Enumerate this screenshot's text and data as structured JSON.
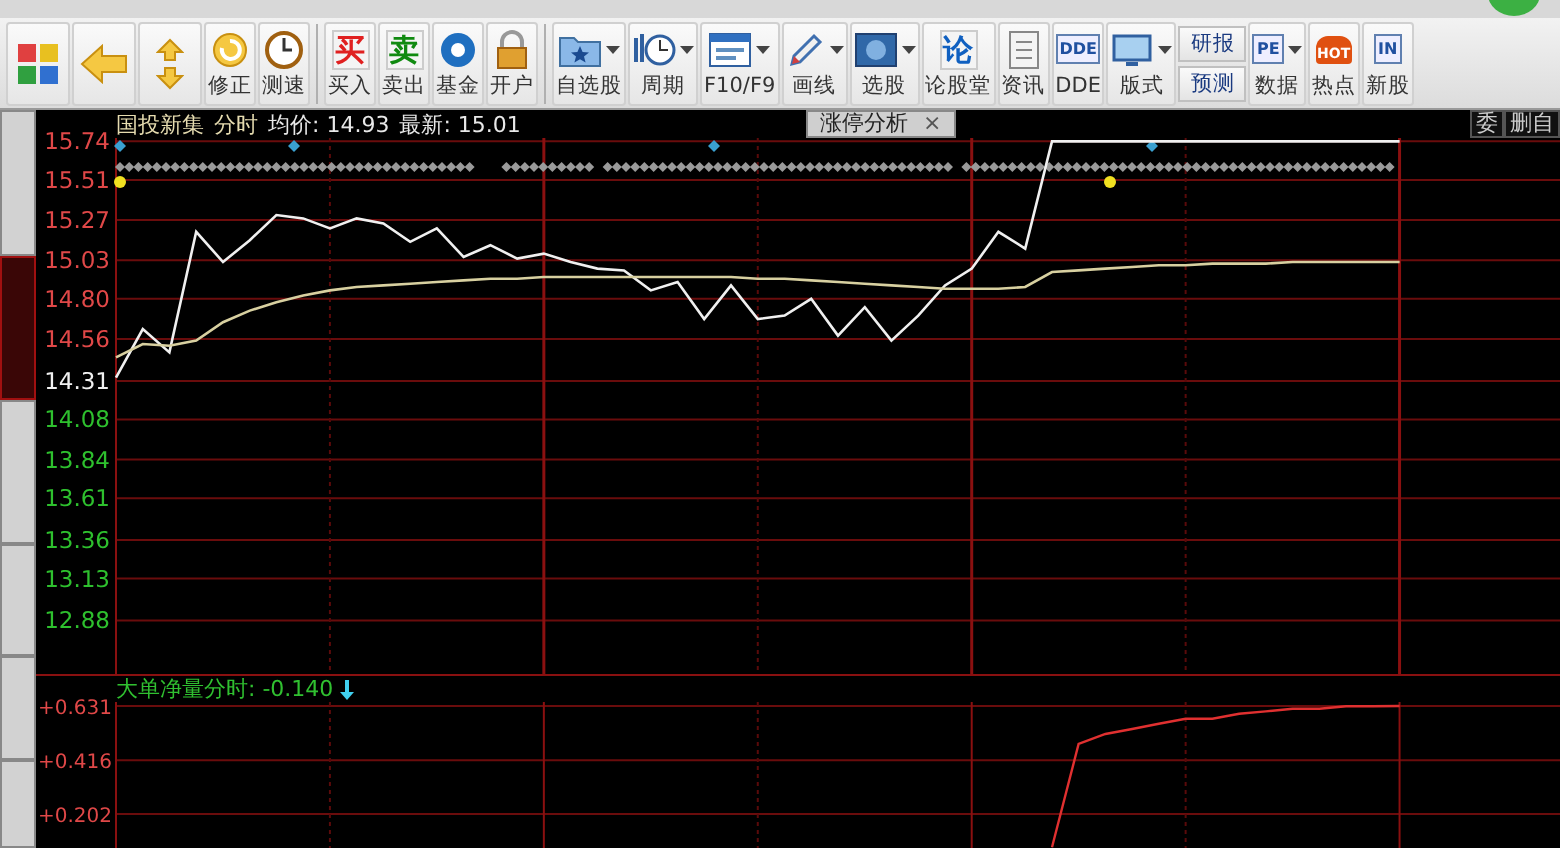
{
  "toolbar": [
    {
      "kind": "tiles"
    },
    {
      "kind": "back"
    },
    {
      "kind": "updown"
    },
    {
      "kind": "refresh",
      "label": "修正"
    },
    {
      "kind": "clock",
      "label": "测速"
    },
    {
      "kind": "sep"
    },
    {
      "kind": "glyph",
      "glyph": "买",
      "color": "#e02020",
      "label": "买入"
    },
    {
      "kind": "glyph",
      "glyph": "卖",
      "color": "#108a10",
      "label": "卖出"
    },
    {
      "kind": "disc",
      "label": "基金"
    },
    {
      "kind": "lock",
      "label": "开户"
    },
    {
      "kind": "sep"
    },
    {
      "kind": "folder",
      "label": "自选股",
      "dropdown": true
    },
    {
      "kind": "period",
      "label": "周期",
      "dropdown": true
    },
    {
      "kind": "window",
      "label": "F10/F9",
      "dropdown": true
    },
    {
      "kind": "pencil",
      "label": "画线",
      "dropdown": true
    },
    {
      "kind": "monitor",
      "label": "选股",
      "dropdown": true
    },
    {
      "kind": "glyph",
      "glyph": "论",
      "color": "#1060c0",
      "label": "论股堂"
    },
    {
      "kind": "doc",
      "label": "资讯"
    },
    {
      "kind": "tag",
      "tag": "DDE",
      "label": "DDE"
    },
    {
      "kind": "screen",
      "label": "版式",
      "dropdown": true
    },
    {
      "kind": "pair",
      "labels": [
        "研报",
        "预测"
      ]
    },
    {
      "kind": "tag",
      "tag": "PE",
      "label": "数据",
      "dropdown": true
    },
    {
      "kind": "fire",
      "tag": "HOT",
      "label": "热点"
    },
    {
      "kind": "tag",
      "tag": "IN",
      "label": "新股"
    }
  ],
  "sidebar": {
    "tabs": [
      {
        "selected": false
      },
      {
        "selected": true
      },
      {
        "selected": false
      },
      {
        "selected": false
      },
      {
        "selected": false
      },
      {
        "selected": false
      }
    ]
  },
  "header": {
    "stock": "国投新集",
    "mode": "分时",
    "average": "均价: 14.93",
    "latest": "最新: 15.01",
    "tab": {
      "label": "涨停分析",
      "close": "×"
    },
    "right_items": [
      "委",
      "删自"
    ]
  },
  "chart_data": {
    "type": "line",
    "grid": true,
    "ylim": [
      12.56,
      15.76
    ],
    "yticks": [
      {
        "value": 15.74,
        "label": "15.74"
      },
      {
        "value": 15.51,
        "label": "15.51"
      },
      {
        "value": 15.27,
        "label": "15.27"
      },
      {
        "value": 15.03,
        "label": "15.03"
      },
      {
        "value": 14.8,
        "label": "14.80"
      },
      {
        "value": 14.56,
        "label": "14.56"
      },
      {
        "value": 14.31,
        "label": "14.31"
      },
      {
        "value": 14.08,
        "label": "14.08"
      },
      {
        "value": 13.84,
        "label": "13.84"
      },
      {
        "value": 13.61,
        "label": "13.61"
      },
      {
        "value": 13.36,
        "label": "13.36"
      },
      {
        "value": 13.13,
        "label": "13.13"
      },
      {
        "value": 12.88,
        "label": "12.88"
      }
    ],
    "series": [
      {
        "color": "#f0f0f0",
        "values": [
          14.33,
          14.62,
          14.48,
          15.2,
          15.02,
          15.15,
          15.3,
          15.28,
          15.22,
          15.28,
          15.25,
          15.14,
          15.22,
          15.05,
          15.12,
          15.04,
          15.07,
          15.02,
          14.98,
          14.97,
          14.85,
          14.9,
          14.68,
          14.88,
          14.68,
          14.7,
          14.8,
          14.58,
          14.75,
          14.55,
          14.7,
          14.88,
          14.98,
          15.2,
          15.1,
          15.74,
          15.74,
          15.74,
          15.74,
          15.74,
          15.74,
          15.74,
          15.74,
          15.74,
          15.74,
          15.74,
          15.74,
          15.74,
          15.74
        ]
      },
      {
        "color": "#d8d0a0",
        "values": [
          14.45,
          14.53,
          14.52,
          14.55,
          14.66,
          14.73,
          14.78,
          14.82,
          14.85,
          14.87,
          14.88,
          14.89,
          14.9,
          14.91,
          14.92,
          14.92,
          14.93,
          14.93,
          14.93,
          14.93,
          14.93,
          14.93,
          14.93,
          14.93,
          14.92,
          14.92,
          14.91,
          14.9,
          14.89,
          14.88,
          14.87,
          14.86,
          14.86,
          14.86,
          14.87,
          14.96,
          14.97,
          14.98,
          14.99,
          15.0,
          15.0,
          15.01,
          15.01,
          15.01,
          15.02,
          15.02,
          15.02,
          15.02,
          15.02
        ]
      }
    ]
  },
  "sub_chart": {
    "title": "大单净量分时: -0.140",
    "chart_data": {
      "type": "line",
      "grid": true,
      "ylim": [
        0.067,
        0.647
      ],
      "yticks": [
        {
          "value": 0.631,
          "label": "+0.631"
        },
        {
          "value": 0.416,
          "label": "+0.416"
        },
        {
          "value": 0.202,
          "label": "+0.202"
        }
      ],
      "series": [
        {
          "color": "#e03030",
          "values": [
            null,
            null,
            null,
            null,
            null,
            null,
            null,
            null,
            null,
            null,
            null,
            null,
            null,
            null,
            null,
            null,
            null,
            null,
            null,
            null,
            null,
            null,
            null,
            null,
            null,
            null,
            null,
            null,
            null,
            null,
            null,
            null,
            null,
            null,
            null,
            0.07,
            0.48,
            0.52,
            0.54,
            0.56,
            0.58,
            0.58,
            0.6,
            0.61,
            0.62,
            0.62,
            0.63,
            0.63,
            0.631
          ]
        }
      ]
    }
  }
}
